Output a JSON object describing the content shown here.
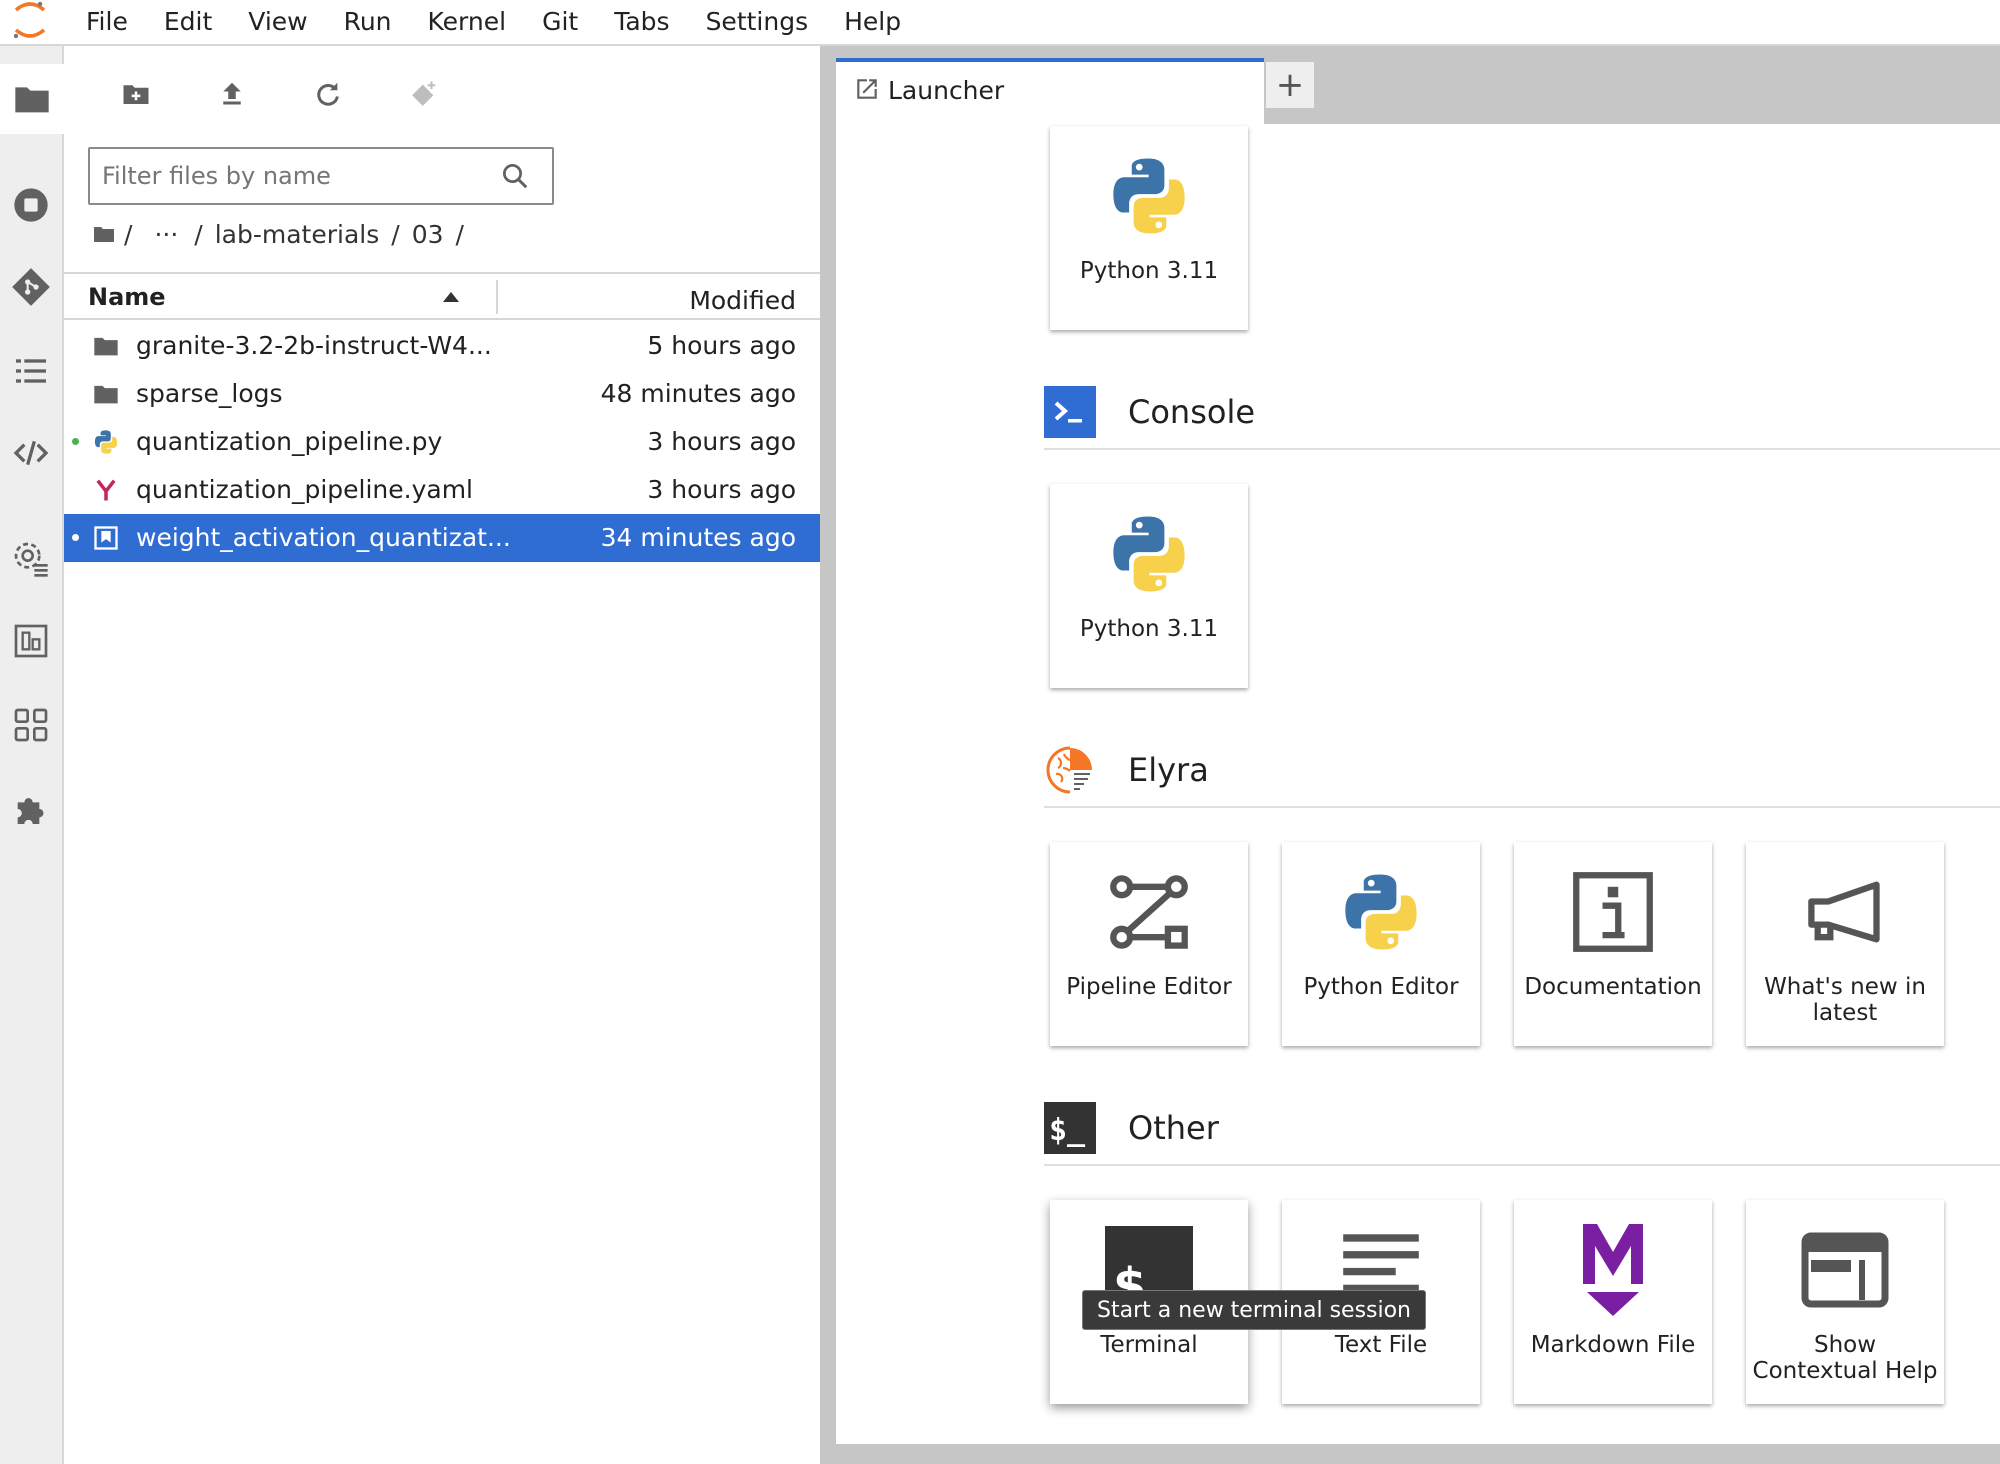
{
  "menubar": {
    "items": [
      "File",
      "Edit",
      "View",
      "Run",
      "Kernel",
      "Git",
      "Tabs",
      "Settings",
      "Help"
    ]
  },
  "activity_bar": {
    "icons": [
      "folder-icon",
      "stop-circle-icon",
      "git-icon",
      "table-of-contents-icon",
      "code-snippets-icon",
      "runtimes-icon",
      "component-catalogs-icon",
      "property-inspector-icon",
      "extensions-icon"
    ],
    "active": "folder-icon"
  },
  "filebrowser": {
    "toolbar": [
      "new-folder-icon",
      "upload-icon",
      "refresh-icon",
      "git-clone-icon"
    ],
    "filter_placeholder": "Filter files by name",
    "breadcrumbs": [
      "/",
      "···",
      "/",
      "lab-materials",
      "/",
      "03",
      "/"
    ],
    "header": {
      "name": "Name",
      "modified": "Modified"
    },
    "files": [
      {
        "name": "granite-3.2-2b-instruct-W4...",
        "modified": "5 hours ago",
        "type": "folder",
        "running": false,
        "selected": false
      },
      {
        "name": "sparse_logs",
        "modified": "48 minutes ago",
        "type": "folder",
        "running": false,
        "selected": false
      },
      {
        "name": "quantization_pipeline.py",
        "modified": "3 hours ago",
        "type": "python",
        "running": true,
        "selected": false
      },
      {
        "name": "quantization_pipeline.yaml",
        "modified": "3 hours ago",
        "type": "yaml",
        "running": false,
        "selected": false
      },
      {
        "name": "weight_activation_quantizat...",
        "modified": "34 minutes ago",
        "type": "notebook",
        "running": true,
        "selected": true
      }
    ]
  },
  "tabs": {
    "active_label": "Launcher",
    "add_label": "+"
  },
  "launcher": {
    "notebook_cards": [
      {
        "label": "Python 3.11",
        "icon": "python-icon"
      }
    ],
    "console": {
      "title": "Console",
      "cards": [
        {
          "label": "Python 3.11",
          "icon": "python-icon"
        }
      ]
    },
    "elyra": {
      "title": "Elyra",
      "cards": [
        {
          "label": "Pipeline Editor",
          "icon": "pipeline-icon"
        },
        {
          "label": "Python Editor",
          "icon": "python-icon"
        },
        {
          "label": "Documentation",
          "icon": "info-icon"
        },
        {
          "label": "What's new in latest",
          "icon": "megaphone-icon"
        }
      ]
    },
    "other": {
      "title": "Other",
      "cards": [
        {
          "label": "Terminal",
          "icon": "terminal-icon"
        },
        {
          "label": "Text File",
          "icon": "text-file-icon"
        },
        {
          "label": "Markdown File",
          "icon": "markdown-icon"
        },
        {
          "label": "Show Contextual Help",
          "icon": "contextual-help-icon"
        }
      ]
    },
    "tooltip": "Start a new terminal session"
  },
  "colors": {
    "accent": "#2f6dd3",
    "python_blue": "#3c73a8",
    "python_yellow": "#f7d04c",
    "markdown_purple": "#7b1fa2",
    "yaml_red": "#c4255a",
    "jupyter_orange": "#f37726"
  }
}
